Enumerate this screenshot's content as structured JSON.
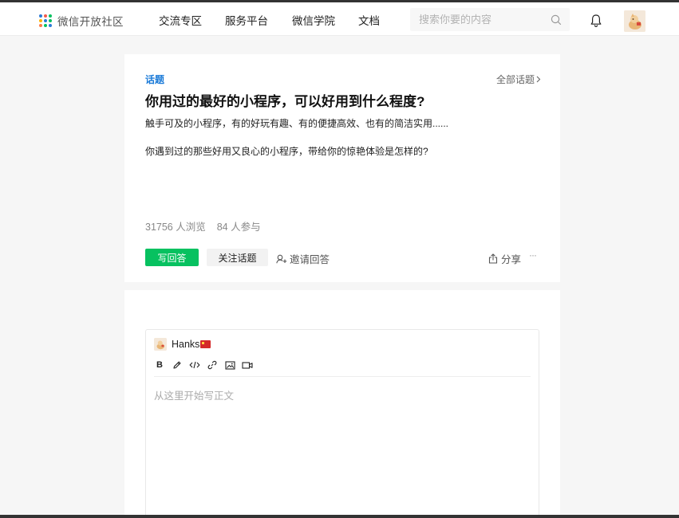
{
  "brand": {
    "name": "微信开放社区",
    "dot_colors": [
      "#2b7bd6",
      "#f45b4b",
      "#07c160",
      "#ffb300",
      "#2b7bd6",
      "#07c160",
      "#ff7a45",
      "#07c160",
      "#2b7bd6"
    ]
  },
  "nav": {
    "links": [
      "交流专区",
      "服务平台",
      "微信学院",
      "文档"
    ]
  },
  "search": {
    "placeholder": "搜索你要的内容"
  },
  "topic": {
    "label": "话题",
    "all_topics": "全部话题",
    "title": "你用过的最好的小程序，可以好用到什么程度?",
    "desc1": "触手可及的小程序，有的好玩有趣、有的便捷高效、也有的简洁实用......",
    "desc2": "你遇到过的那些好用又良心的小程序，带给你的惊艳体验是怎样的?",
    "views": "31756 人浏览",
    "participants": "84 人参与",
    "write_answer": "写回答",
    "follow": "关注话题",
    "invite": "邀请回答",
    "share": "分享",
    "more": "···"
  },
  "editor": {
    "username": "Hanks",
    "placeholder": "从这里开始写正文",
    "tools": [
      "bold-icon",
      "pen-icon",
      "code-icon",
      "link-icon",
      "image-icon",
      "video-icon"
    ],
    "bold_label": "B"
  },
  "colors": {
    "accent_green": "#07c160",
    "link_blue": "#1a7ad8",
    "background": "#f6f6f6"
  }
}
